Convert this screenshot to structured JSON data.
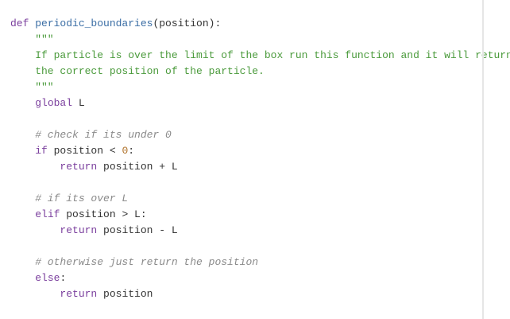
{
  "code": {
    "lines": [
      {
        "parts": [
          {
            "t": "def ",
            "c": "kw"
          },
          {
            "t": "periodic_boundaries",
            "c": "fn"
          },
          {
            "t": "(position):",
            "c": "plain"
          }
        ]
      },
      {
        "parts": [
          {
            "t": "    \"\"\"",
            "c": "str"
          }
        ]
      },
      {
        "parts": [
          {
            "t": "    If particle is over the limit of the box run this function and it will return",
            "c": "str"
          }
        ]
      },
      {
        "parts": [
          {
            "t": "    the correct position of the particle.",
            "c": "str"
          }
        ]
      },
      {
        "parts": [
          {
            "t": "    \"\"\"",
            "c": "str"
          }
        ]
      },
      {
        "parts": [
          {
            "t": "    ",
            "c": "plain"
          },
          {
            "t": "global",
            "c": "kw"
          },
          {
            "t": " L",
            "c": "plain"
          }
        ]
      },
      {
        "parts": [
          {
            "t": "",
            "c": "plain"
          }
        ]
      },
      {
        "parts": [
          {
            "t": "    # check if its under 0",
            "c": "cmt"
          }
        ]
      },
      {
        "parts": [
          {
            "t": "    ",
            "c": "plain"
          },
          {
            "t": "if",
            "c": "kw"
          },
          {
            "t": " position < ",
            "c": "plain"
          },
          {
            "t": "0",
            "c": "num"
          },
          {
            "t": ":",
            "c": "plain"
          }
        ]
      },
      {
        "parts": [
          {
            "t": "        ",
            "c": "plain"
          },
          {
            "t": "return",
            "c": "kw"
          },
          {
            "t": " position + L",
            "c": "plain"
          }
        ]
      },
      {
        "parts": [
          {
            "t": "",
            "c": "plain"
          }
        ]
      },
      {
        "parts": [
          {
            "t": "    # if its over L",
            "c": "cmt"
          }
        ]
      },
      {
        "parts": [
          {
            "t": "    ",
            "c": "plain"
          },
          {
            "t": "elif",
            "c": "kw"
          },
          {
            "t": " position > L:",
            "c": "plain"
          }
        ]
      },
      {
        "parts": [
          {
            "t": "        ",
            "c": "plain"
          },
          {
            "t": "return",
            "c": "kw"
          },
          {
            "t": " position - L",
            "c": "plain"
          }
        ]
      },
      {
        "parts": [
          {
            "t": "",
            "c": "plain"
          }
        ]
      },
      {
        "parts": [
          {
            "t": "    # otherwise just return the position",
            "c": "cmt"
          }
        ]
      },
      {
        "parts": [
          {
            "t": "    ",
            "c": "plain"
          },
          {
            "t": "else",
            "c": "kw"
          },
          {
            "t": ":",
            "c": "plain"
          }
        ]
      },
      {
        "parts": [
          {
            "t": "        ",
            "c": "plain"
          },
          {
            "t": "return",
            "c": "kw"
          },
          {
            "t": " position",
            "c": "plain"
          }
        ]
      }
    ]
  },
  "colors": {
    "keyword": "#7a3e9d",
    "function": "#3b6ea5",
    "string": "#4a9a3b",
    "comment": "#8a8a8a",
    "number": "#b0722a",
    "text": "#333333"
  }
}
